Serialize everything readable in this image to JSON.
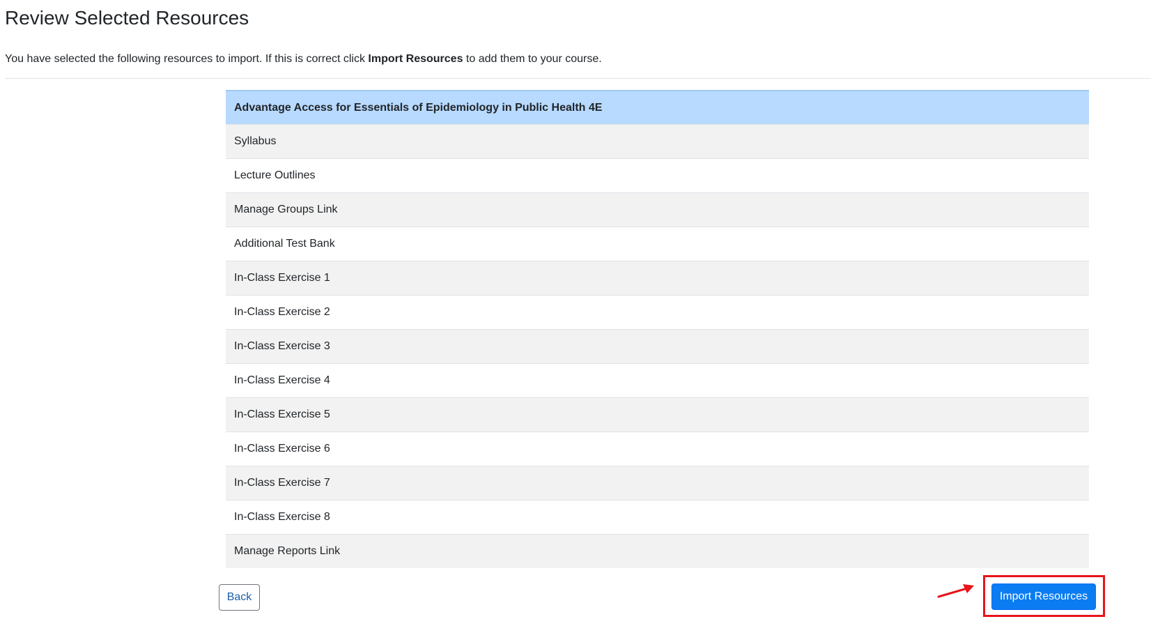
{
  "page": {
    "title": "Review Selected Resources",
    "instructions_before": "You have selected the following resources to import. If this is correct click ",
    "instructions_bold": "Import Resources",
    "instructions_after": " to add them to your course."
  },
  "resources": {
    "header": "Advantage Access for Essentials of Epidemiology in Public Health 4E",
    "items": [
      "Syllabus",
      "Lecture Outlines",
      "Manage Groups Link",
      "Additional Test Bank",
      "In-Class Exercise 1",
      "In-Class Exercise 2",
      "In-Class Exercise 3",
      "In-Class Exercise 4",
      "In-Class Exercise 5",
      "In-Class Exercise 6",
      "In-Class Exercise 7",
      "In-Class Exercise 8",
      "Manage Reports Link"
    ]
  },
  "actions": {
    "back_label": "Back",
    "import_label": "Import Resources"
  },
  "annotation": {
    "arrow_icon": "red-arrow-icon",
    "highlight_color": "#e8141b"
  }
}
